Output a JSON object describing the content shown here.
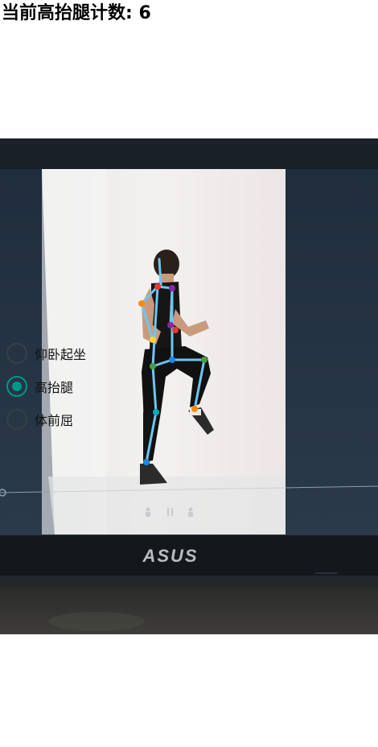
{
  "header": {
    "count_text": "当前高抬腿计数: 6"
  },
  "exercise_options": [
    {
      "label": "仰卧起坐",
      "checked": false
    },
    {
      "label": "高抬腿",
      "checked": true
    },
    {
      "label": "体前屈",
      "checked": false
    }
  ],
  "camera": {
    "logo_text": "ASUS",
    "player_icons": [
      "stand-figure-icon",
      "pause-icon",
      "stand-figure-icon"
    ]
  },
  "colors": {
    "accent": "#009688",
    "skeleton_line": "#6ec6f0"
  }
}
